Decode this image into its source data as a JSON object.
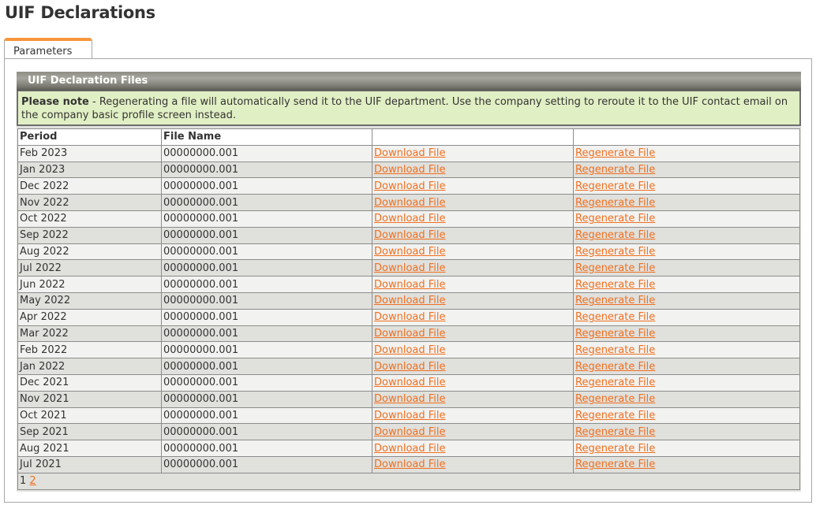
{
  "page": {
    "title": "UIF Declarations"
  },
  "tabs": [
    {
      "label": "Parameters",
      "active": true
    }
  ],
  "section": {
    "title": "UIF Declaration Files",
    "note_bold": "Please note",
    "note_text": " - Regenerating a file will automatically send it to the UIF department. Use the company setting to reroute it to the UIF contact email on the company basic profile screen instead."
  },
  "table": {
    "columns": [
      "Period",
      "File Name",
      "",
      ""
    ],
    "rows": [
      {
        "period": "Feb 2023",
        "file_name": "00000000.001",
        "download": "Download File",
        "regenerate": "Regenerate File"
      },
      {
        "period": "Jan 2023",
        "file_name": "00000000.001",
        "download": "Download File",
        "regenerate": "Regenerate File"
      },
      {
        "period": "Dec 2022",
        "file_name": "00000000.001",
        "download": "Download File",
        "regenerate": "Regenerate File"
      },
      {
        "period": "Nov 2022",
        "file_name": "00000000.001",
        "download": "Download File",
        "regenerate": "Regenerate File"
      },
      {
        "period": "Oct 2022",
        "file_name": "00000000.001",
        "download": "Download File",
        "regenerate": "Regenerate File"
      },
      {
        "period": "Sep 2022",
        "file_name": "00000000.001",
        "download": "Download File",
        "regenerate": "Regenerate File"
      },
      {
        "period": "Aug 2022",
        "file_name": "00000000.001",
        "download": "Download File",
        "regenerate": "Regenerate File"
      },
      {
        "period": "Jul 2022",
        "file_name": "00000000.001",
        "download": "Download File",
        "regenerate": "Regenerate File"
      },
      {
        "period": "Jun 2022",
        "file_name": "00000000.001",
        "download": "Download File",
        "regenerate": "Regenerate File"
      },
      {
        "period": "May 2022",
        "file_name": "00000000.001",
        "download": "Download File",
        "regenerate": "Regenerate File"
      },
      {
        "period": "Apr 2022",
        "file_name": "00000000.001",
        "download": "Download File",
        "regenerate": "Regenerate File"
      },
      {
        "period": "Mar 2022",
        "file_name": "00000000.001",
        "download": "Download File",
        "regenerate": "Regenerate File"
      },
      {
        "period": "Feb 2022",
        "file_name": "00000000.001",
        "download": "Download File",
        "regenerate": "Regenerate File"
      },
      {
        "period": "Jan 2022",
        "file_name": "00000000.001",
        "download": "Download File",
        "regenerate": "Regenerate File"
      },
      {
        "period": "Dec 2021",
        "file_name": "00000000.001",
        "download": "Download File",
        "regenerate": "Regenerate File"
      },
      {
        "period": "Nov 2021",
        "file_name": "00000000.001",
        "download": "Download File",
        "regenerate": "Regenerate File"
      },
      {
        "period": "Oct 2021",
        "file_name": "00000000.001",
        "download": "Download File",
        "regenerate": "Regenerate File"
      },
      {
        "period": "Sep 2021",
        "file_name": "00000000.001",
        "download": "Download File",
        "regenerate": "Regenerate File"
      },
      {
        "period": "Aug 2021",
        "file_name": "00000000.001",
        "download": "Download File",
        "regenerate": "Regenerate File"
      },
      {
        "period": "Jul 2021",
        "file_name": "00000000.001",
        "download": "Download File",
        "regenerate": "Regenerate File"
      }
    ]
  },
  "pagination": {
    "current": "1",
    "pages": [
      "2"
    ]
  },
  "colors": {
    "accent": "#f7963c",
    "link": "#f07020",
    "note_bg": "#e1efc4"
  }
}
